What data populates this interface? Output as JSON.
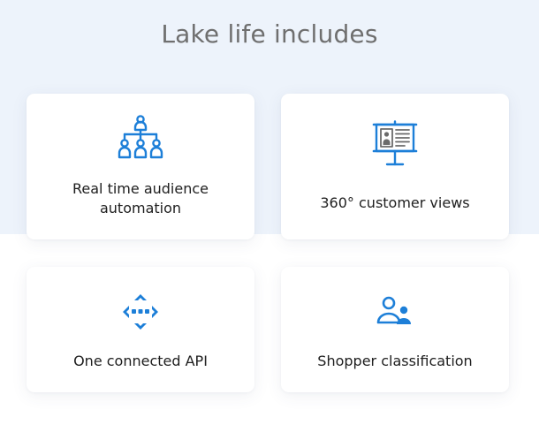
{
  "section": {
    "title": "Lake life includes"
  },
  "cards": [
    {
      "label": "Real time audience automation",
      "icon": "org-chart-icon"
    },
    {
      "label": "360° customer views",
      "icon": "presentation-board-icon"
    },
    {
      "label": "One connected API",
      "icon": "arrows-connected-icon"
    },
    {
      "label": "Shopper classification",
      "icon": "users-icon"
    }
  ],
  "colors": {
    "accent": "#1d7fd8",
    "top_background": "#edf3fb",
    "title": "#6f6f6f"
  }
}
